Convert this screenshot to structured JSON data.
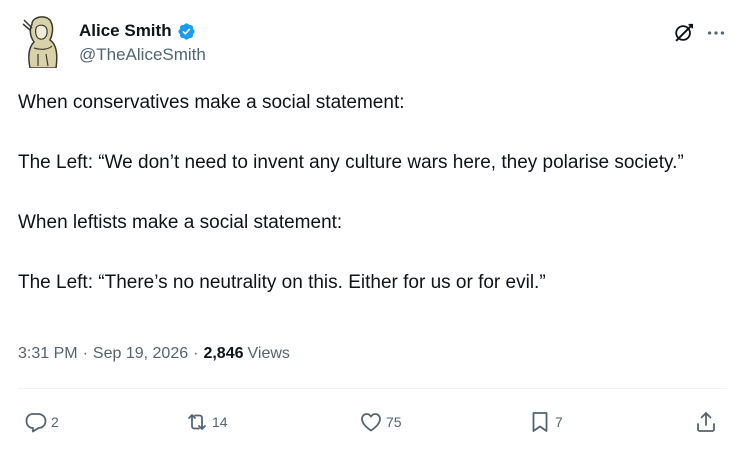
{
  "author": {
    "display_name": "Alice Smith",
    "handle": "@TheAliceSmith",
    "verified": true
  },
  "tweet": {
    "paragraphs": [
      "When conservatives make a social statement:",
      "The Left: “We don’t need to invent any culture wars here, they polarise society.”",
      "When leftists make a social statement:",
      "The Left: “There’s no neutrality on this. Either for us or for evil.”"
    ]
  },
  "meta": {
    "time": "3:31 PM",
    "separator": "·",
    "date": "Sep 19, 2026",
    "views_count": "2,846",
    "views_label": "Views"
  },
  "actions": {
    "replies": "2",
    "retweets": "14",
    "likes": "75",
    "bookmarks": "7"
  },
  "colors": {
    "text": "#0f1419",
    "secondary": "#536471",
    "verified": "#1d9bf0",
    "divider": "#eff3f4"
  },
  "icons": [
    "avatar",
    "verified-badge-icon",
    "grok-icon",
    "more-icon",
    "reply-icon",
    "retweet-icon",
    "like-icon",
    "bookmark-icon",
    "share-icon"
  ]
}
